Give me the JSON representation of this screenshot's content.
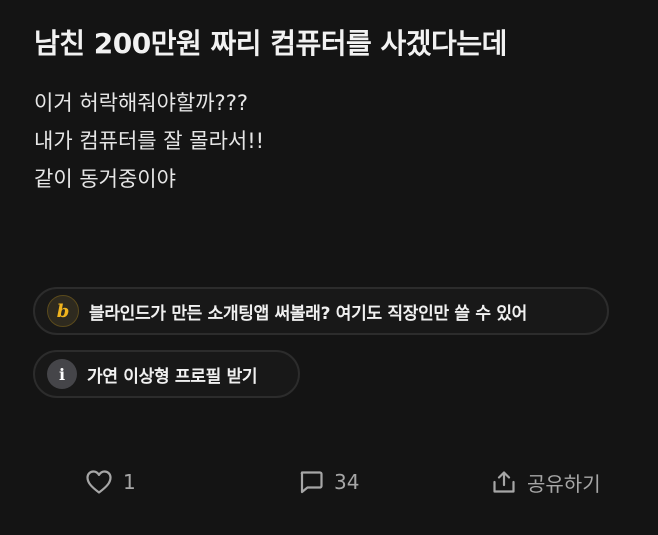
{
  "post": {
    "title": "남친 200만원 짜리 컴퓨터를 사겠다는데",
    "body_lines": [
      "이거 허락해줘야할까???",
      "내가 컴퓨터를 잘 몰라서!!",
      "같이 동거중이야"
    ]
  },
  "chips": {
    "blind": {
      "icon_glyph": "b",
      "icon": "blind-logo-icon",
      "label": "블라인드가 만든 소개팅앱 써볼래? 여기도 직장인만 쓸 수 있어"
    },
    "profile": {
      "icon_glyph": "i",
      "icon": "info-icon",
      "label": "가연 이상형 프로필 받기"
    }
  },
  "actions": {
    "like": {
      "icon": "heart-icon",
      "count": "1"
    },
    "comment": {
      "icon": "comment-icon",
      "count": "34"
    },
    "share": {
      "icon": "share-icon",
      "label": "공유하기"
    }
  },
  "colors": {
    "background": "#141414",
    "text": "#e9e9e9",
    "muted": "#a6a6a6",
    "blind_accent": "#f0b41e"
  }
}
